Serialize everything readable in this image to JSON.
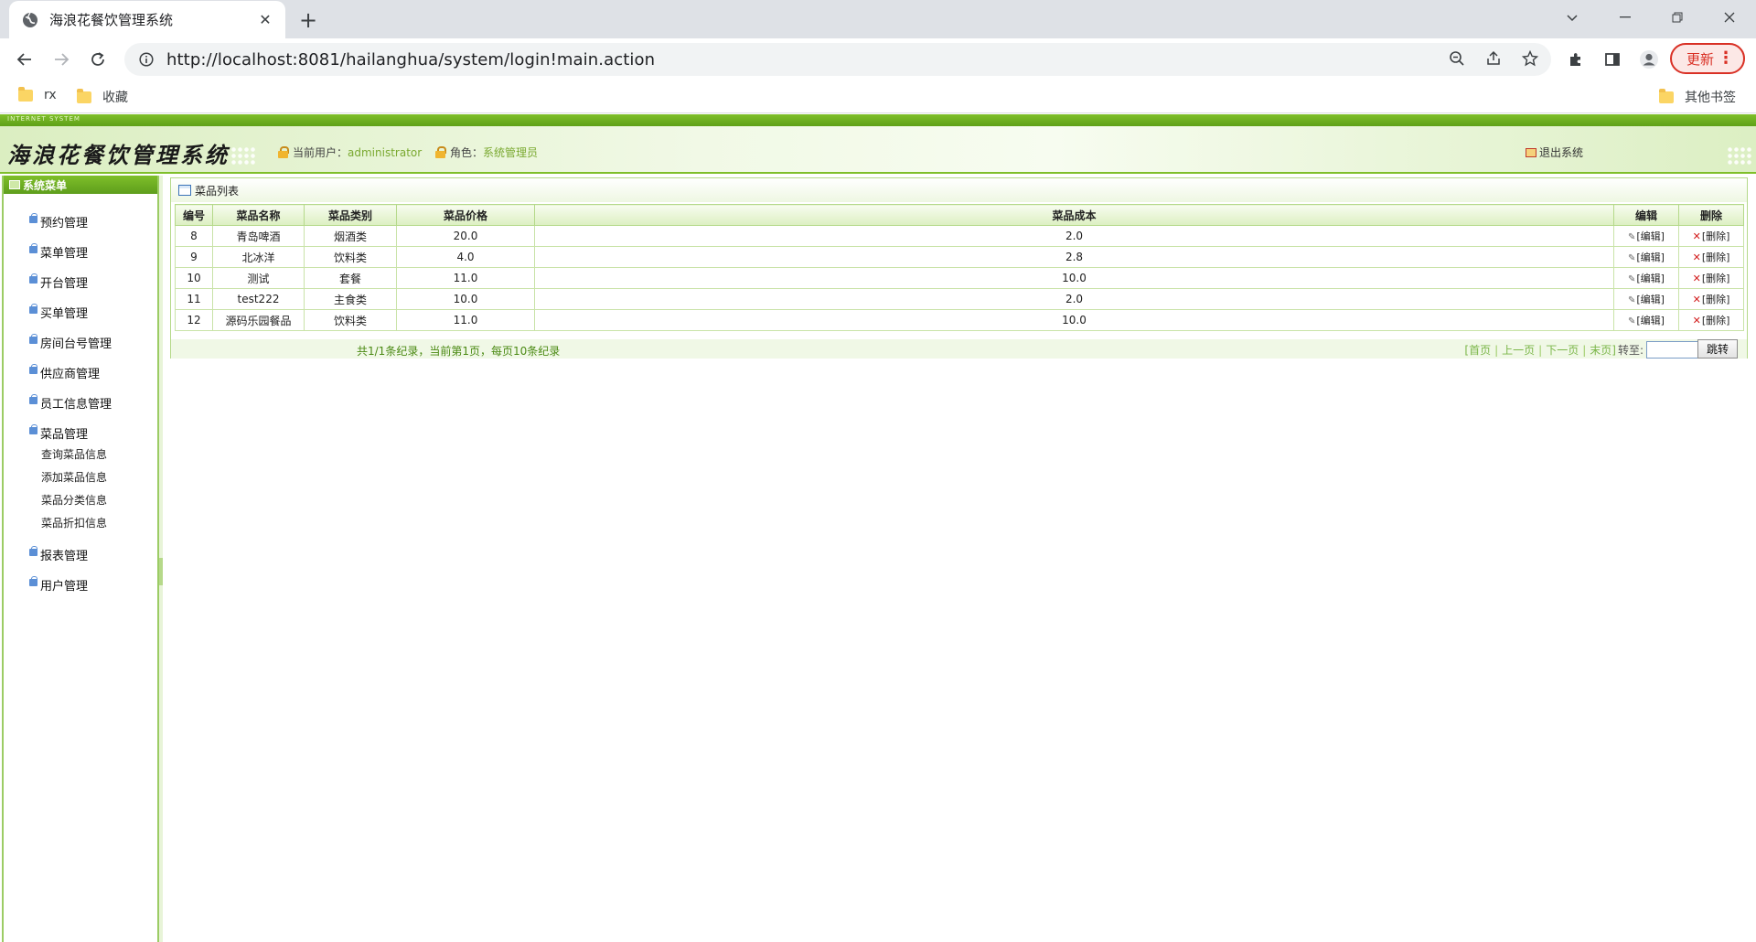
{
  "browser": {
    "tab_title": "海浪花餐饮管理系统",
    "url": "http://localhost:8081/hailanghua/system/login!main.action",
    "update_label": "更新",
    "bookmarks": [
      "rx",
      "收藏"
    ],
    "other_bookmarks": "其他书签"
  },
  "app": {
    "top_label": "INTERNET SYSTEM",
    "logo_text": "海浪花餐饮管理系统",
    "current_user_label": "当前用户：",
    "current_user": "administrator",
    "role_label": "角色：",
    "role": "系统管理员",
    "logout_label": "退出系统"
  },
  "sidebar": {
    "title": "系统菜单",
    "items": [
      {
        "label": "预约管理"
      },
      {
        "label": "菜单管理"
      },
      {
        "label": "开台管理"
      },
      {
        "label": "买单管理"
      },
      {
        "label": "房间台号管理"
      },
      {
        "label": "供应商管理"
      },
      {
        "label": "员工信息管理"
      },
      {
        "label": "菜品管理",
        "sub": [
          "查询菜品信息",
          "添加菜品信息",
          "菜品分类信息",
          "菜品折扣信息"
        ]
      },
      {
        "label": "报表管理"
      },
      {
        "label": "用户管理"
      }
    ]
  },
  "panel": {
    "title": "菜品列表",
    "columns": [
      "编号",
      "菜品名称",
      "菜品类别",
      "菜品价格",
      "菜品成本",
      "编辑",
      "删除"
    ],
    "rows": [
      [
        "8",
        "青岛啤酒",
        "烟酒类",
        "20.0",
        "2.0"
      ],
      [
        "9",
        "北冰洋",
        "饮料类",
        "4.0",
        "2.8"
      ],
      [
        "10",
        "测试",
        "套餐",
        "11.0",
        "10.0"
      ],
      [
        "11",
        "test222",
        "主食类",
        "10.0",
        "2.0"
      ],
      [
        "12",
        "源码乐园餐品",
        "饮料类",
        "11.0",
        "10.0"
      ]
    ],
    "edit_label": "[编辑]",
    "delete_label": "[删除]",
    "pager": {
      "summary": "共1/1条纪录，当前第1页，每页10条纪录",
      "first": "[首页",
      "prev": "上一页",
      "next": "下一页",
      "last": "末页]",
      "goto_label": "转至:",
      "go_button": "跳转"
    }
  }
}
